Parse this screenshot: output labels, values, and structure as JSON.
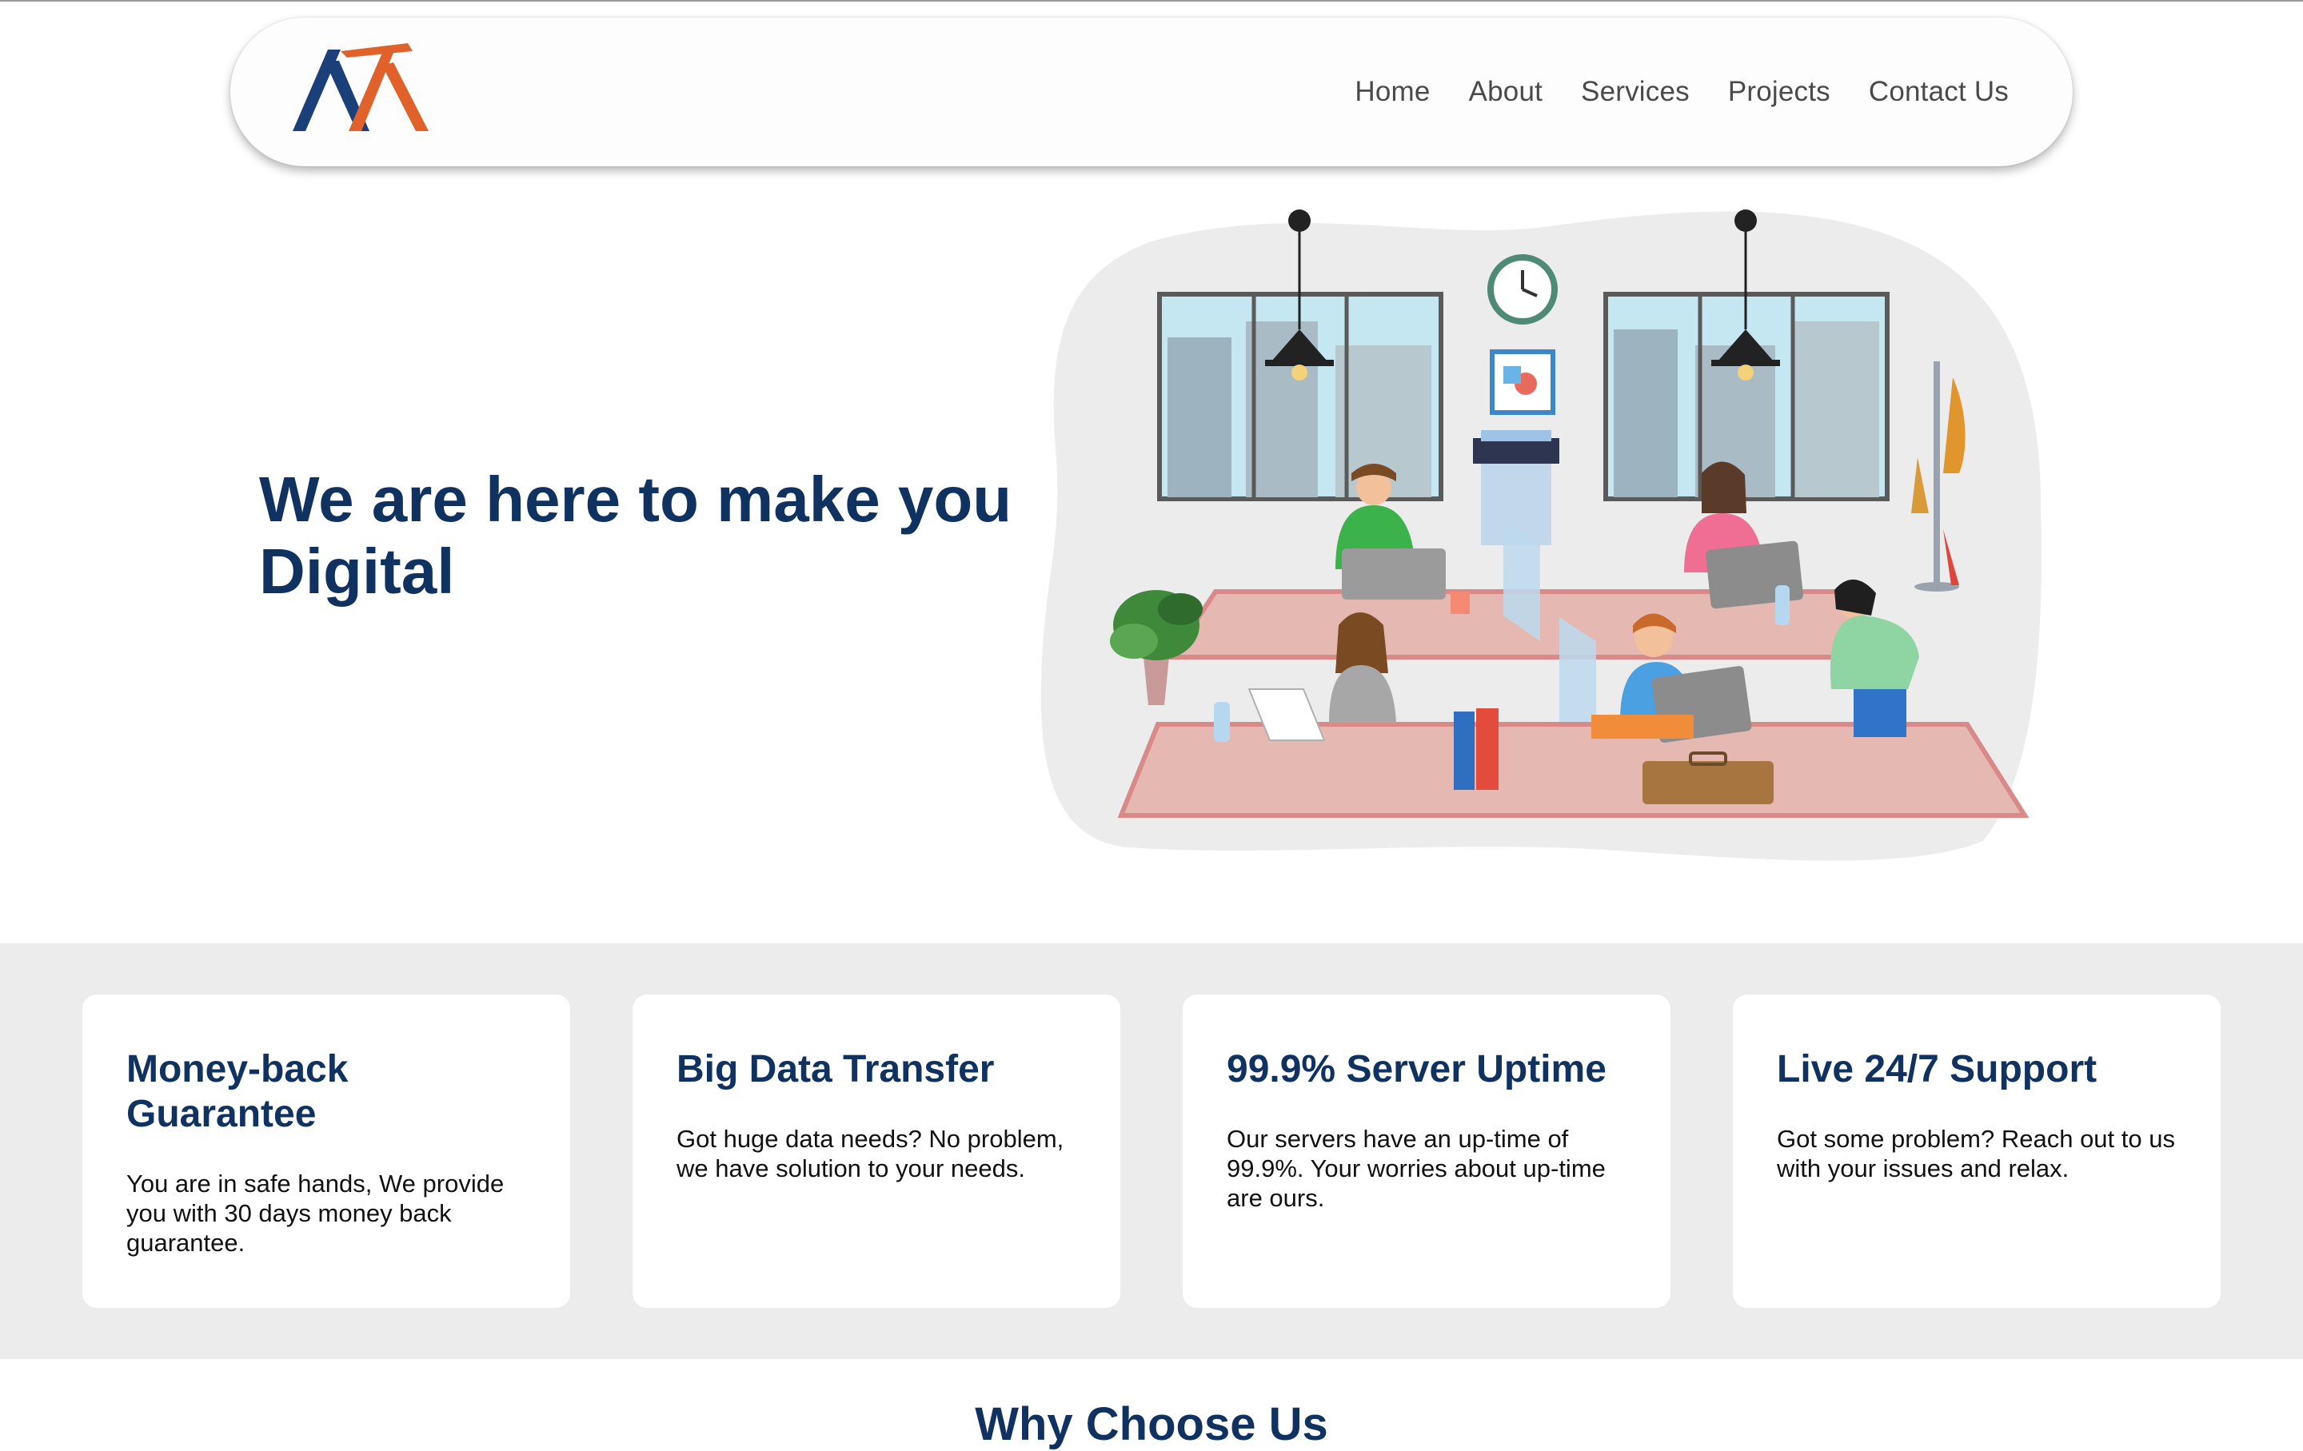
{
  "nav": {
    "links": [
      "Home",
      "About",
      "Services",
      "Projects",
      "Contact Us"
    ]
  },
  "hero": {
    "title_line1": "We are here to make you",
    "title_line2": "Digital"
  },
  "features": [
    {
      "title": "Money-back Guarantee",
      "text": "You are in safe hands, We provide you with 30 days money back guarantee."
    },
    {
      "title": "Big Data Transfer",
      "text": "Got huge data needs? No problem, we have solution to your needs."
    },
    {
      "title": "99.9% Server Uptime",
      "text": "Our servers have an up-time of 99.9%. Your worries about up-time are ours."
    },
    {
      "title": "Live 24/7 Support",
      "text": "Got some problem? Reach out to us with your issues and relax."
    }
  ],
  "why": {
    "title": "Why Choose Us"
  },
  "colors": {
    "brand_navy": "#0f3261",
    "brand_orange": "#e0622a",
    "band_gray": "#ececec"
  }
}
